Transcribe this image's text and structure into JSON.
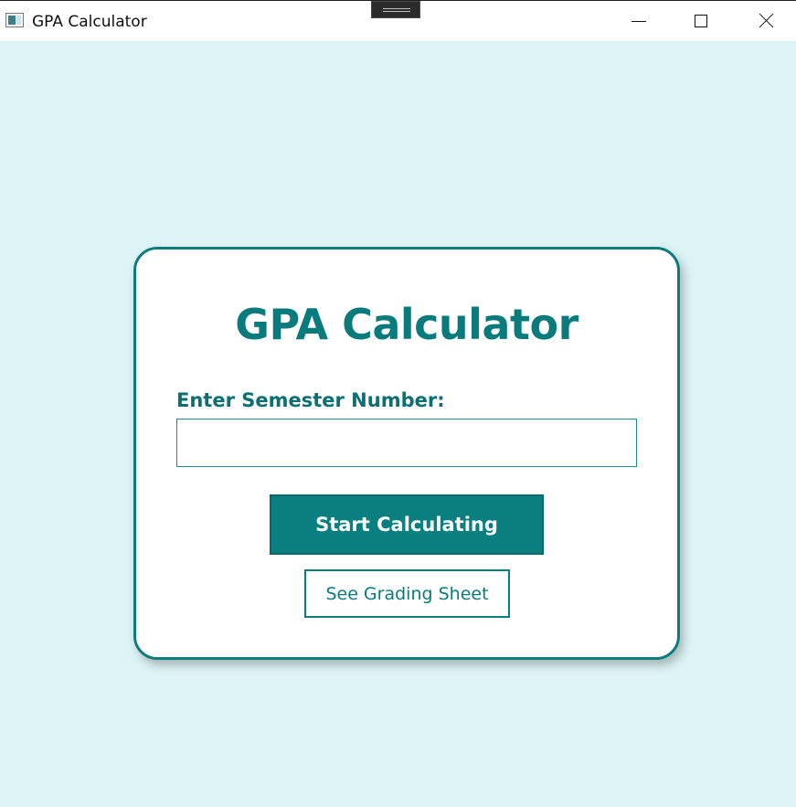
{
  "window": {
    "title": "GPA Calculator",
    "icon": "app-window-icon"
  },
  "caption_buttons": {
    "minimize": "minimize-icon",
    "maximize": "maximize-icon",
    "close": "close-icon"
  },
  "card": {
    "title": "GPA Calculator",
    "field_label": "Enter Semester Number:",
    "semester_input": {
      "value": "",
      "placeholder": ""
    },
    "start_button_label": "Start Calculating",
    "grading_button_label": "See Grading Sheet"
  },
  "colors": {
    "background": "#dcf4f6",
    "accent": "#0a7f80",
    "card": "#ffffff"
  }
}
